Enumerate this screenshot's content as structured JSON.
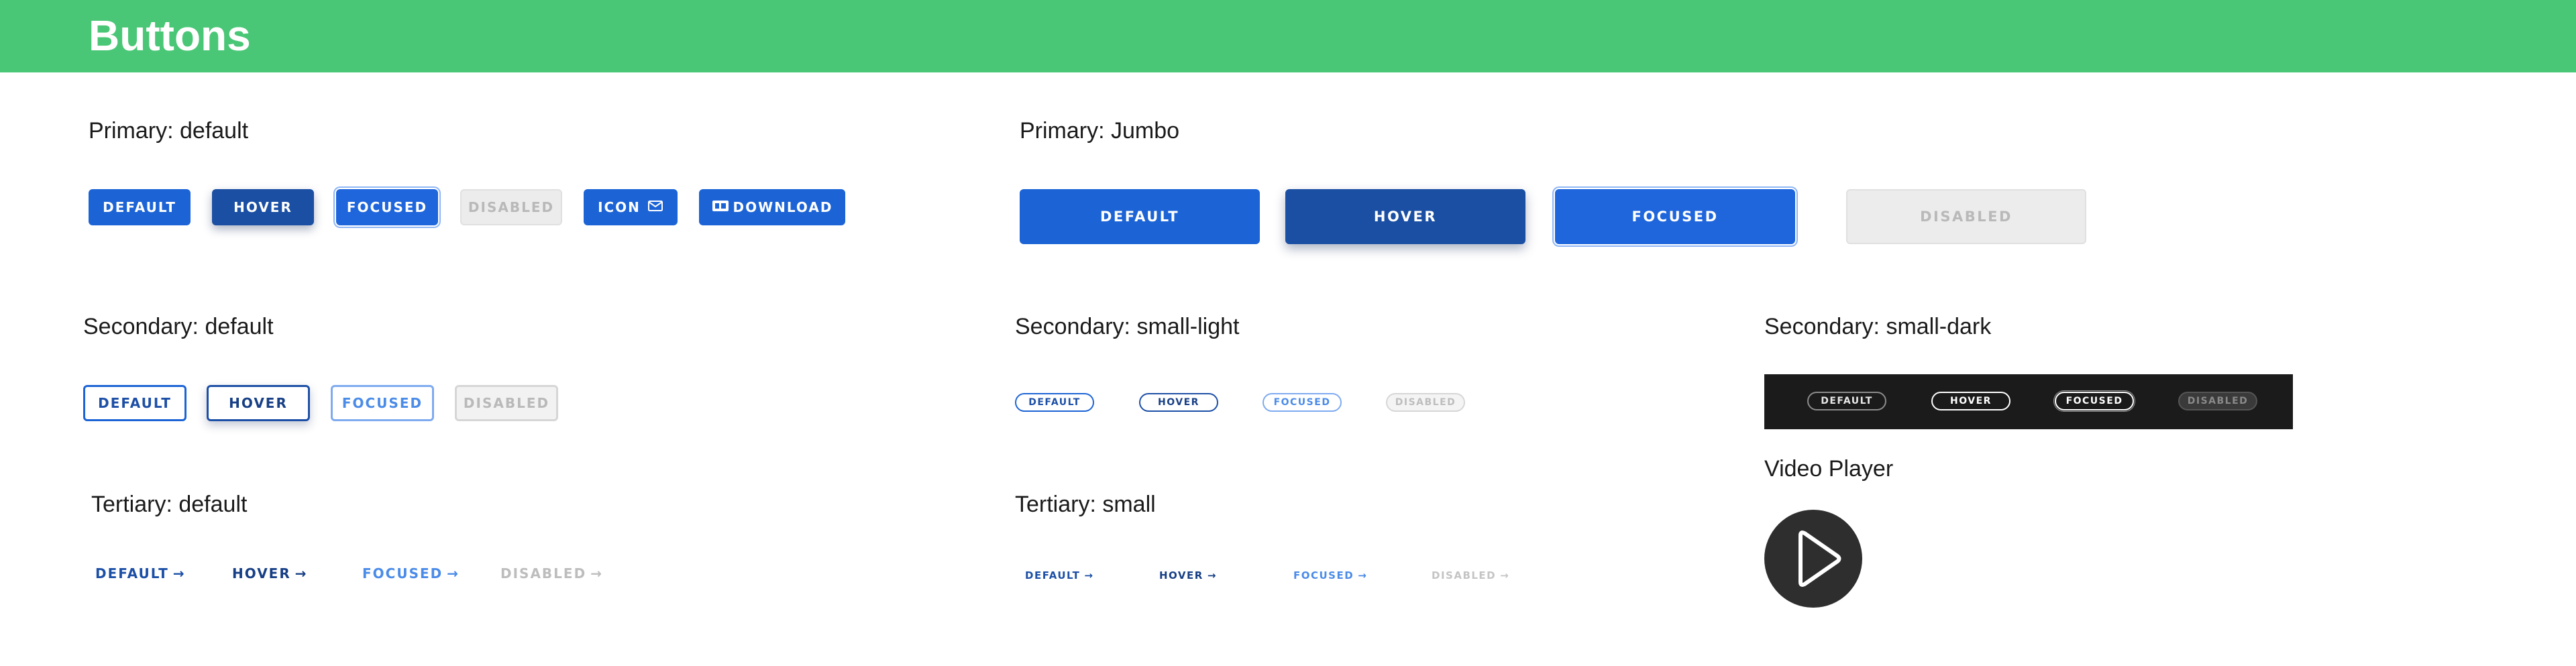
{
  "header": {
    "title": "Buttons"
  },
  "sections": {
    "primary_default": "Primary: default",
    "primary_jumbo": "Primary: Jumbo",
    "secondary_default": "Secondary: default",
    "secondary_small_light": "Secondary: small-light",
    "secondary_small_dark": "Secondary: small-dark",
    "tertiary_default": "Tertiary: default",
    "tertiary_small": "Tertiary: small",
    "video_player": "Video Player"
  },
  "primary_default": {
    "default": "DEFAULT",
    "hover": "HOVER",
    "focused": "FOCUSED",
    "disabled": "DISABLED",
    "icon": "ICON",
    "icon_glyph": "mail-icon",
    "download": "DOWNLOAD",
    "download_glyph": "download-icon"
  },
  "primary_jumbo": {
    "default": "DEFAULT",
    "hover": "HOVER",
    "focused": "FOCUSED",
    "disabled": "DISABLED"
  },
  "secondary_default": {
    "default": "DEFAULT",
    "hover": "HOVER",
    "focused": "FOCUSED",
    "disabled": "DISABLED"
  },
  "secondary_small_light": {
    "default": "DEFAULT",
    "hover": "HOVER",
    "focused": "FOCUSED",
    "disabled": "DISABLED"
  },
  "secondary_small_dark": {
    "default": "DEFAULT",
    "hover": "HOVER",
    "focused": "FOCUSED",
    "disabled": "DISABLED"
  },
  "tertiary_default": {
    "default": "DEFAULT",
    "hover": "HOVER",
    "focused": "FOCUSED",
    "disabled": "DISABLED",
    "arrow": "→"
  },
  "tertiary_small": {
    "default": "DEFAULT",
    "hover": "HOVER",
    "focused": "FOCUSED",
    "disabled": "DISABLED",
    "arrow": "→"
  },
  "video_player": {
    "icon": "play-icon"
  },
  "colors": {
    "header_green": "#4ac776",
    "primary_blue": "#1c64d6",
    "primary_hover": "#1a4fa3",
    "focus_ring": "#8fb6f5",
    "disabled_bg": "#ececec",
    "dark_strip": "#1b1b1b",
    "player_bg": "#2e2e2e"
  }
}
